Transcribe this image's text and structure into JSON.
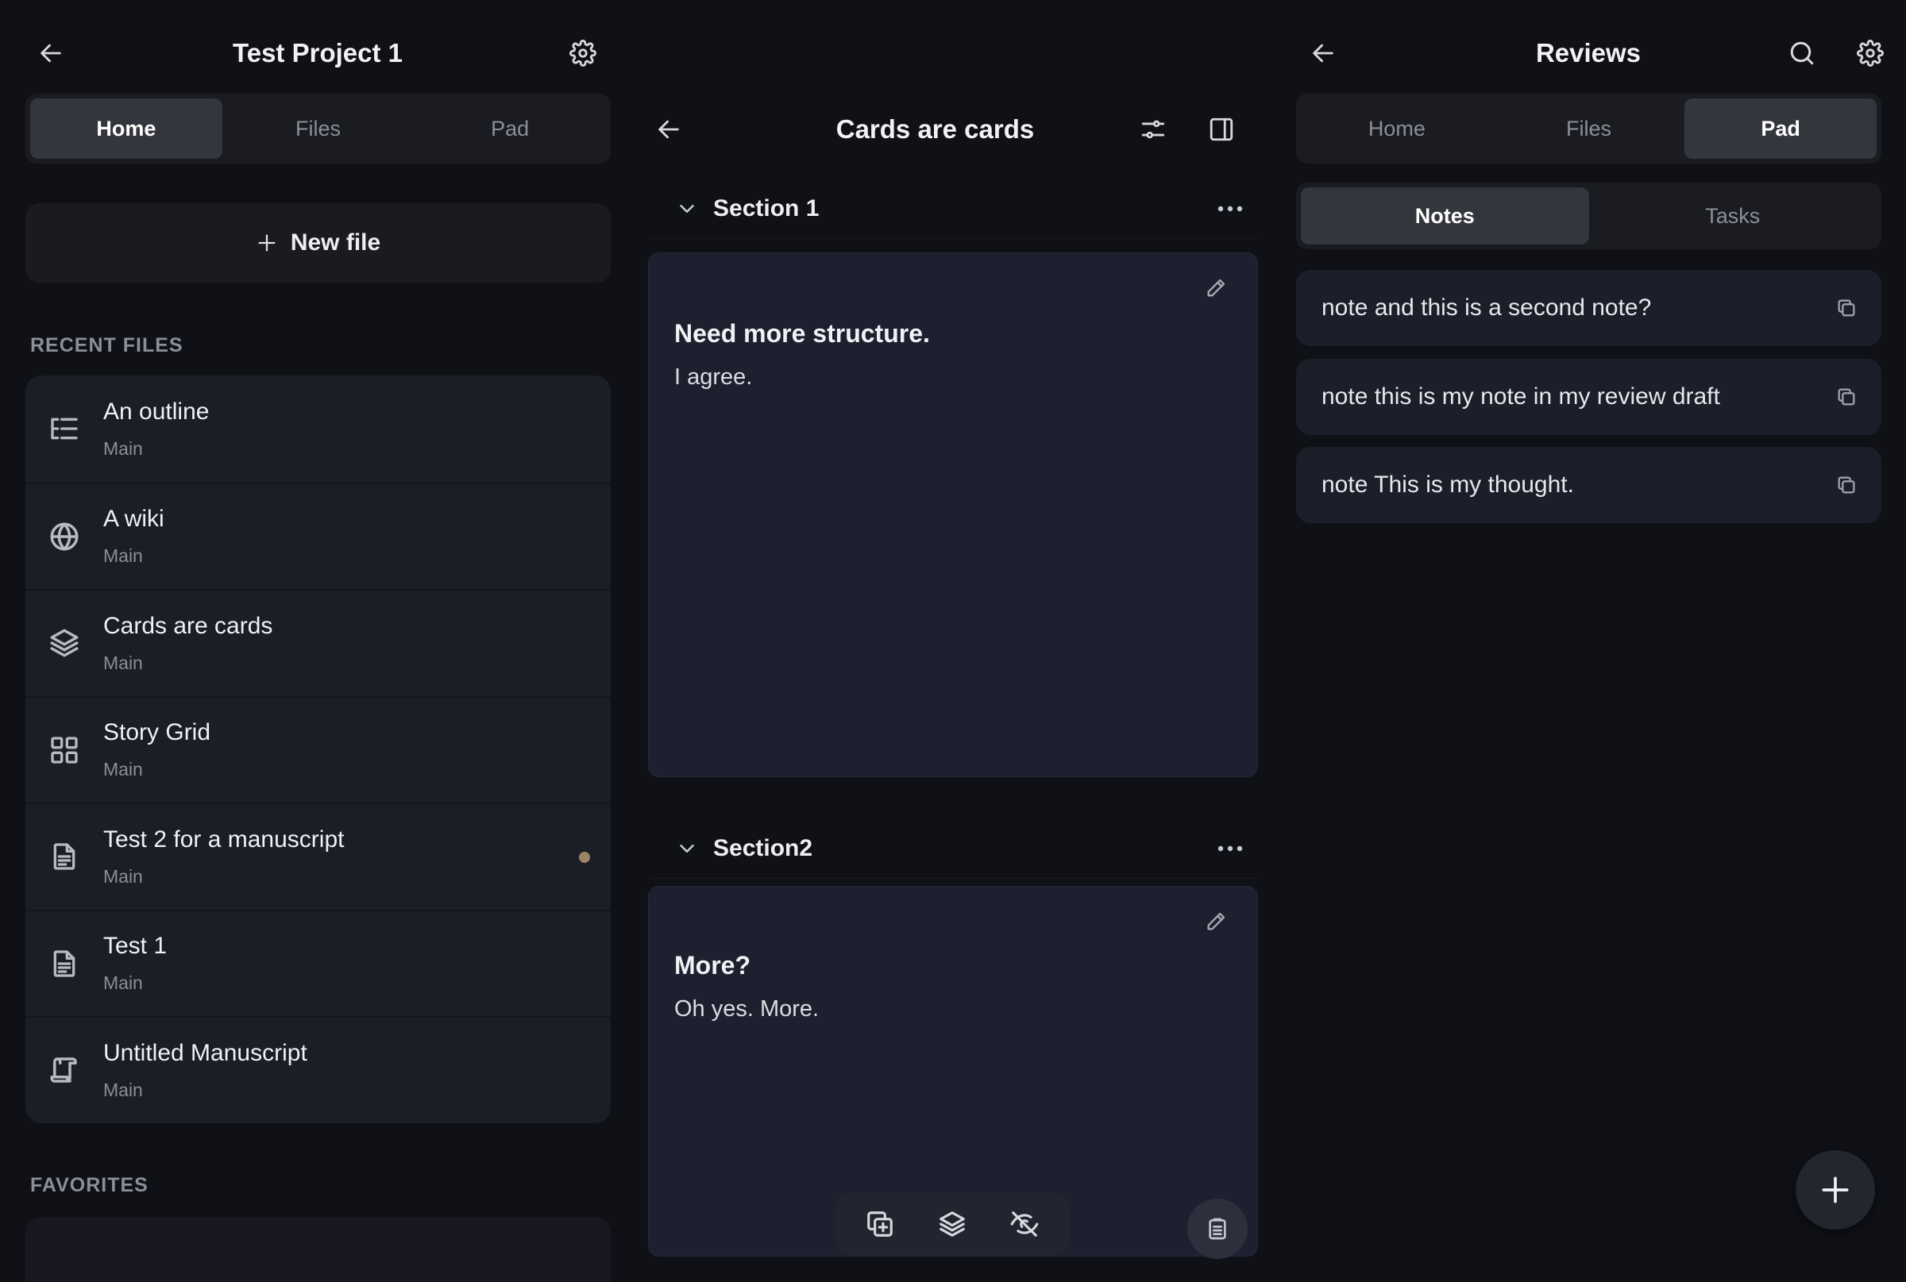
{
  "left": {
    "title": "Test Project 1",
    "tabs": [
      {
        "label": "Home",
        "active": true
      },
      {
        "label": "Files",
        "active": false
      },
      {
        "label": "Pad",
        "active": false
      }
    ],
    "new_file_label": "New file",
    "recent_label": "RECENT FILES",
    "favorites_label": "FAVORITES",
    "files": [
      {
        "name": "An outline",
        "sub": "Main",
        "icon": "outline-icon"
      },
      {
        "name": "A wiki",
        "sub": "Main",
        "icon": "globe-icon"
      },
      {
        "name": "Cards are cards",
        "sub": "Main",
        "icon": "layers-icon"
      },
      {
        "name": "Story Grid",
        "sub": "Main",
        "icon": "grid-icon"
      },
      {
        "name": "Test 2 for a manuscript",
        "sub": "Main",
        "icon": "document-icon",
        "unsaved_dot": true
      },
      {
        "name": "Test 1",
        "sub": "Main",
        "icon": "document-icon"
      },
      {
        "name": "Untitled Manuscript",
        "sub": "Main",
        "icon": "scroll-icon"
      }
    ],
    "dot_color": "#9c8467"
  },
  "middle": {
    "title": "Cards are cards",
    "sections": [
      {
        "name": "Section 1",
        "card": {
          "title": "Need more structure.",
          "body": "I agree."
        }
      },
      {
        "name": "Section2",
        "card": {
          "title": "More?",
          "body": "Oh yes. More."
        }
      }
    ]
  },
  "right": {
    "title": "Reviews",
    "tabs": [
      {
        "label": "Home",
        "active": false
      },
      {
        "label": "Files",
        "active": false
      },
      {
        "label": "Pad",
        "active": true
      }
    ],
    "subtabs": [
      {
        "label": "Notes",
        "active": true
      },
      {
        "label": "Tasks",
        "active": false
      }
    ],
    "notes": [
      "note and this is a second note?",
      "note this is my note in my review draft",
      "note This is my thought."
    ]
  },
  "colors": {
    "background": "#0f1117",
    "card": "#1e2030",
    "active_tab": "#34363d"
  }
}
